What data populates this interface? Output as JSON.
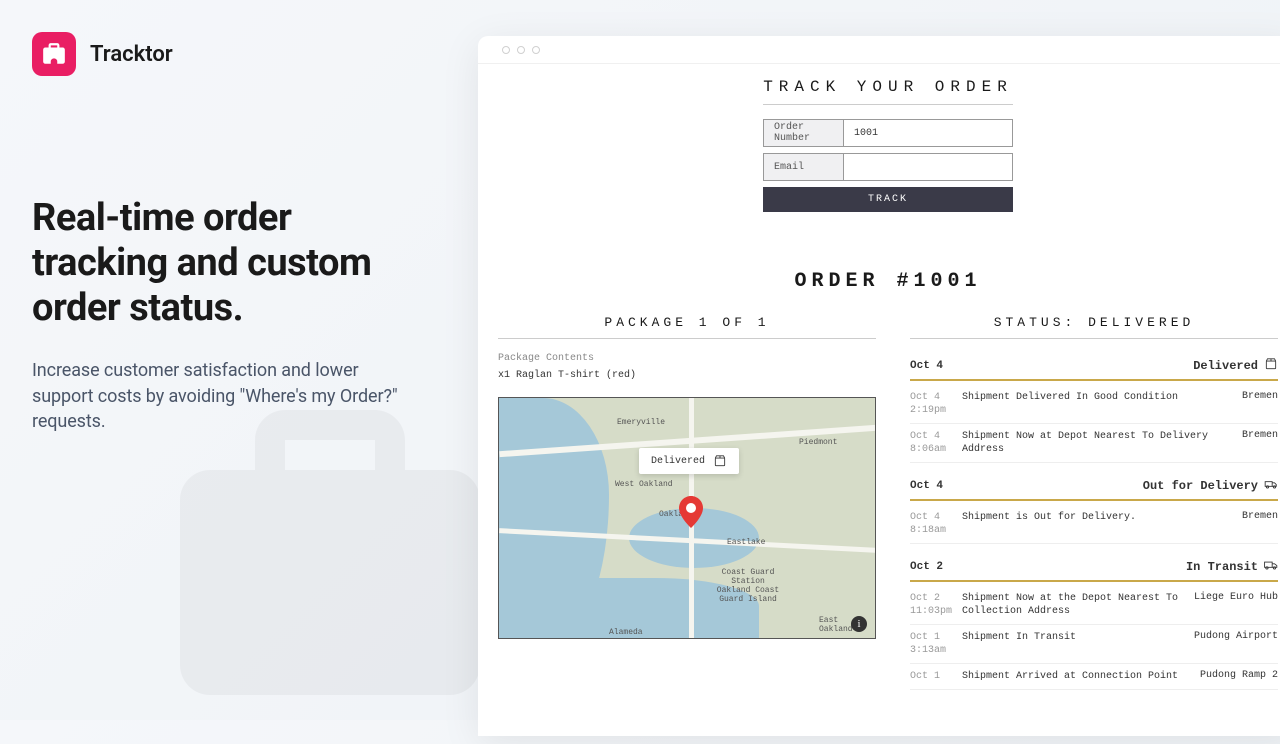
{
  "brand": {
    "name": "Tracktor"
  },
  "marketing": {
    "headline": "Real-time order tracking and custom order status.",
    "subhead": "Increase customer satisfaction and lower support costs by avoiding \"Where's my Order?\" requests."
  },
  "app": {
    "track_title": "TRACK YOUR ORDER",
    "form": {
      "order_label": "Order Number",
      "order_value": "1001",
      "email_label": "Email",
      "email_value": "",
      "button": "TRACK"
    },
    "order_heading": "ORDER #1001",
    "package_heading": "PACKAGE 1 OF 1",
    "status_heading": "STATUS: DELIVERED",
    "contents_label": "Package Contents",
    "contents_item": "x1   Raglan T-shirt (red)",
    "map": {
      "tooltip": "Delivered",
      "labels": [
        "Emeryville",
        "Piedmont",
        "West Oakland",
        "Oakland",
        "Eastlake",
        "Coast Guard Station Oakland Coast Guard Island",
        "Alameda",
        "East Oakland"
      ]
    },
    "status": {
      "groups": [
        {
          "date": "Oct 4",
          "label": "Delivered",
          "icon": "package-icon",
          "events": [
            {
              "date": "Oct 4",
              "time": "2:19pm",
              "msg": "Shipment Delivered In Good Condition",
              "loc": "Bremen"
            },
            {
              "date": "Oct 4",
              "time": "8:06am",
              "msg": "Shipment Now at Depot Nearest To Delivery Address",
              "loc": "Bremen"
            }
          ]
        },
        {
          "date": "Oct 4",
          "label": "Out for Delivery",
          "icon": "delivery-icon",
          "events": [
            {
              "date": "Oct 4",
              "time": "8:18am",
              "msg": "Shipment is Out for Delivery.",
              "loc": "Bremen"
            }
          ]
        },
        {
          "date": "Oct 2",
          "label": "In Transit",
          "icon": "truck-icon",
          "events": [
            {
              "date": "Oct 2",
              "time": "11:03pm",
              "msg": "Shipment Now at the Depot Nearest To Collection Address",
              "loc": "Liege Euro Hub"
            },
            {
              "date": "Oct 1",
              "time": "3:13am",
              "msg": "Shipment In Transit",
              "loc": "Pudong Airport"
            },
            {
              "date": "Oct 1",
              "time": "",
              "msg": "Shipment Arrived at Connection Point",
              "loc": "Pudong Ramp 2"
            }
          ]
        }
      ]
    }
  }
}
